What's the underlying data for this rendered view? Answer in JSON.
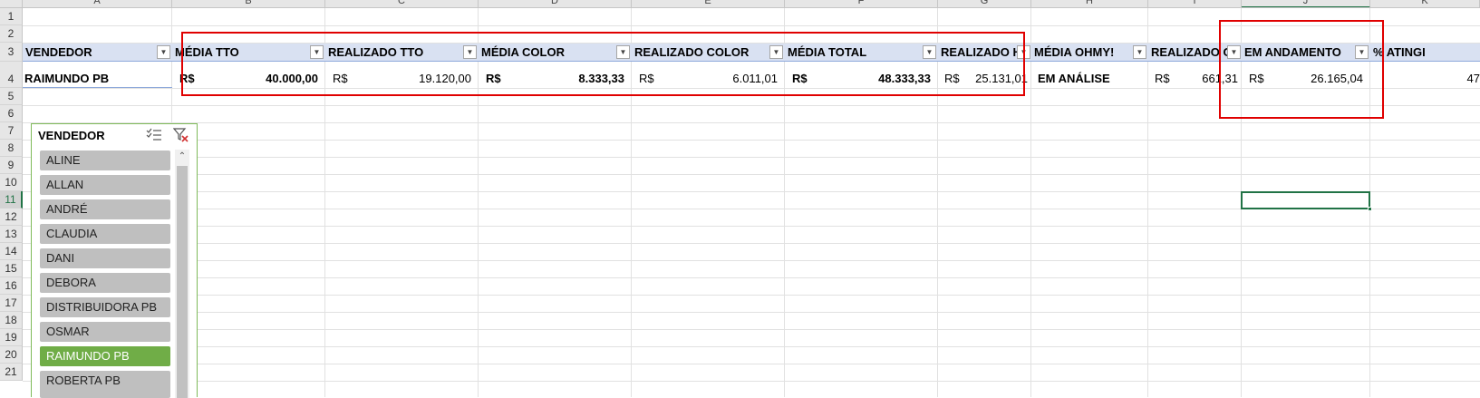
{
  "columns": [
    "A",
    "B",
    "C",
    "D",
    "E",
    "F",
    "G",
    "H",
    "I",
    "J",
    "K"
  ],
  "rows": [
    "1",
    "2",
    "3",
    "4",
    "5",
    "6",
    "7",
    "8",
    "9",
    "10",
    "11",
    "12",
    "13",
    "14",
    "15",
    "16",
    "17",
    "18",
    "19",
    "20",
    "21"
  ],
  "table": {
    "headers": [
      "VENDEDOR",
      "MÉDIA TTO",
      "REALIZADO TTO",
      "MÉDIA COLOR",
      "REALIZADO COLOR",
      "MÉDIA TOTAL",
      "REALIZADO HA",
      "MÉDIA OHMY!",
      "REALIZADO OH",
      "EM ANDAMENTO",
      "% ATINGI"
    ],
    "row": {
      "vendedor": "RAIMUNDO PB",
      "currency": "R$",
      "media_tto": "40.000,00",
      "realizado_tto": "19.120,00",
      "media_color": "8.333,33",
      "realizado_color": "6.011,01",
      "media_total": "48.333,33",
      "realizado_ha": "25.131,01",
      "media_ohmy": "EM ANÁLISE",
      "realizado_oh": "661,31",
      "em_andamento": "26.165,04",
      "atingi": "47"
    },
    "filter_icon": "dropdown-arrow-icon"
  },
  "slicer": {
    "title": "VENDEDOR",
    "items": [
      "ALINE",
      "ALLAN",
      "ANDRÉ",
      "CLAUDIA",
      "DANI",
      "DEBORA",
      "DISTRIBUIDORA PB",
      "OSMAR",
      "RAIMUNDO PB",
      "ROBERTA PB"
    ],
    "selected": "RAIMUNDO PB"
  },
  "colors": {
    "header_fill": "#d9e1f2",
    "slicer_selected": "#70ad47",
    "slicer_item": "#bfbfbf",
    "highlight": "#e00000",
    "excel_green": "#217346"
  }
}
